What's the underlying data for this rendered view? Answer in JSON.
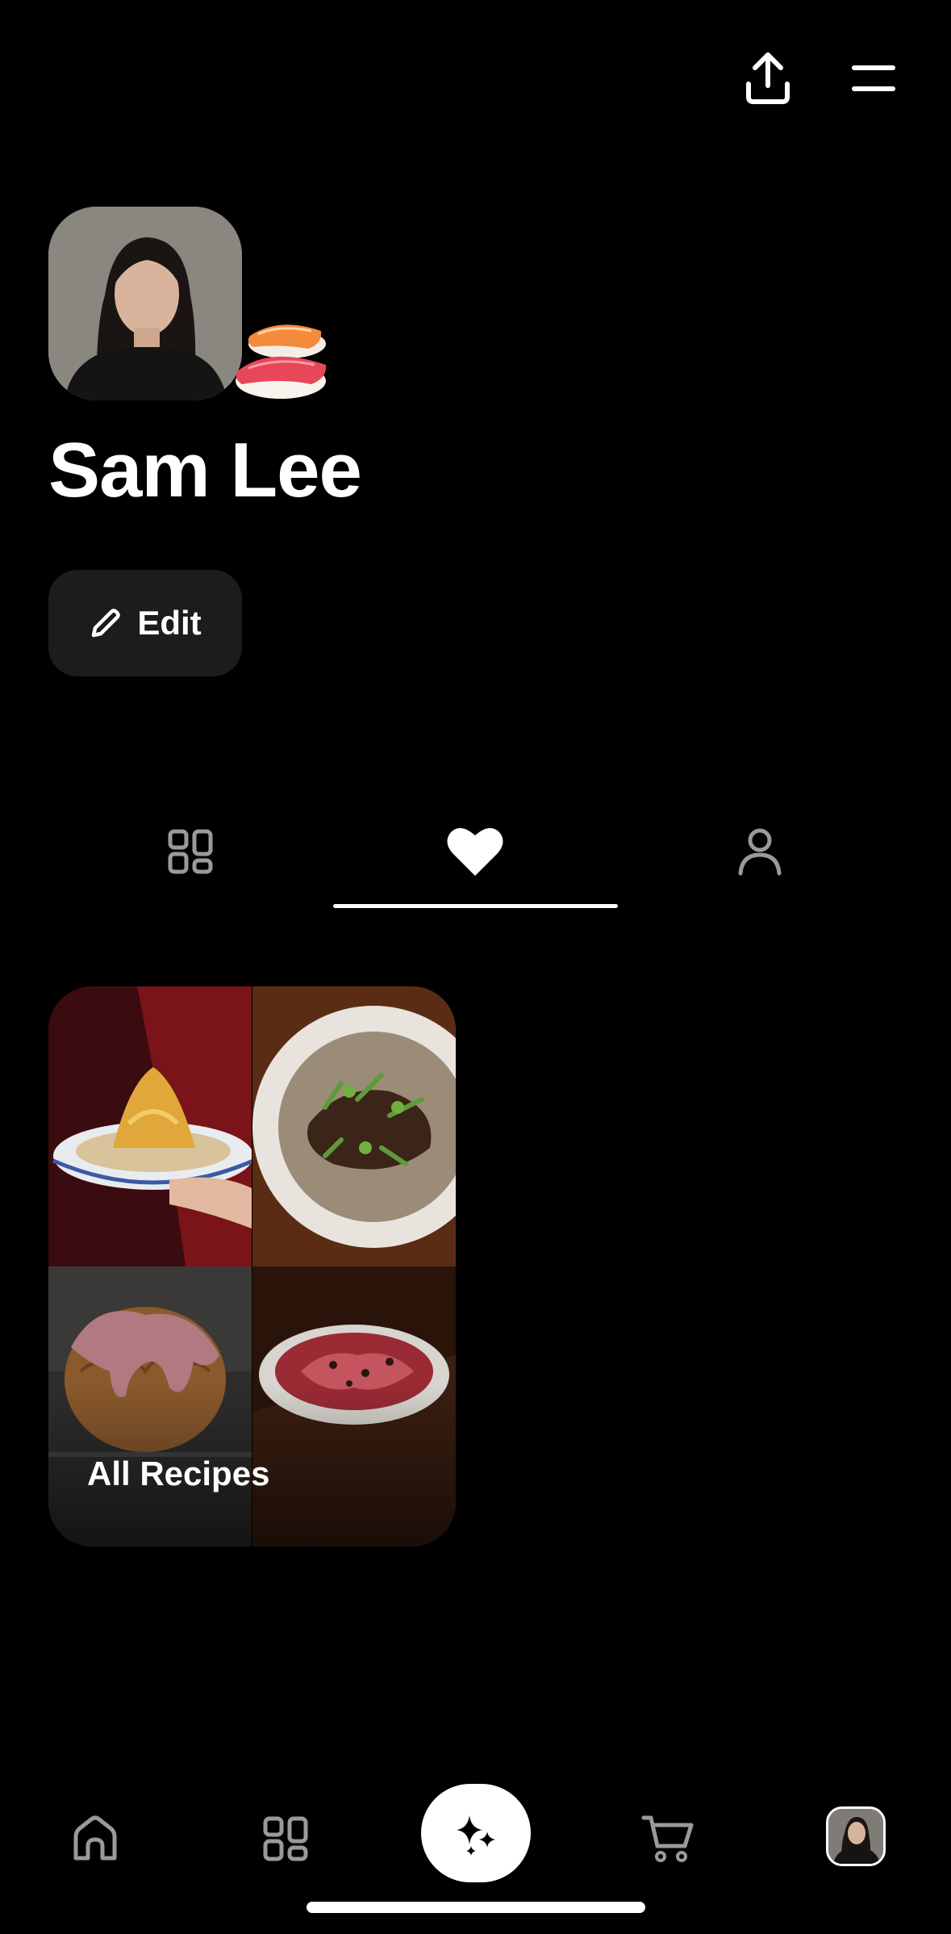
{
  "profile": {
    "name": "Sam Lee",
    "edit_label": "Edit"
  },
  "tabs": [
    {
      "id": "grid",
      "icon": "grid-icon",
      "active": false
    },
    {
      "id": "liked",
      "icon": "heart-icon",
      "active": true
    },
    {
      "id": "following",
      "icon": "person-icon",
      "active": false
    }
  ],
  "collections": [
    {
      "label": "All Recipes"
    }
  ],
  "bottom_nav": [
    {
      "id": "home",
      "icon": "home-icon"
    },
    {
      "id": "browse",
      "icon": "grid-icon"
    },
    {
      "id": "create",
      "icon": "sparkle-icon"
    },
    {
      "id": "cart",
      "icon": "cart-icon"
    },
    {
      "id": "profile",
      "icon": "avatar"
    }
  ],
  "colors": {
    "background": "#000000",
    "button_bg": "#1c1c1e",
    "foreground": "#ffffff",
    "icon_muted": "#9a9a9a"
  }
}
